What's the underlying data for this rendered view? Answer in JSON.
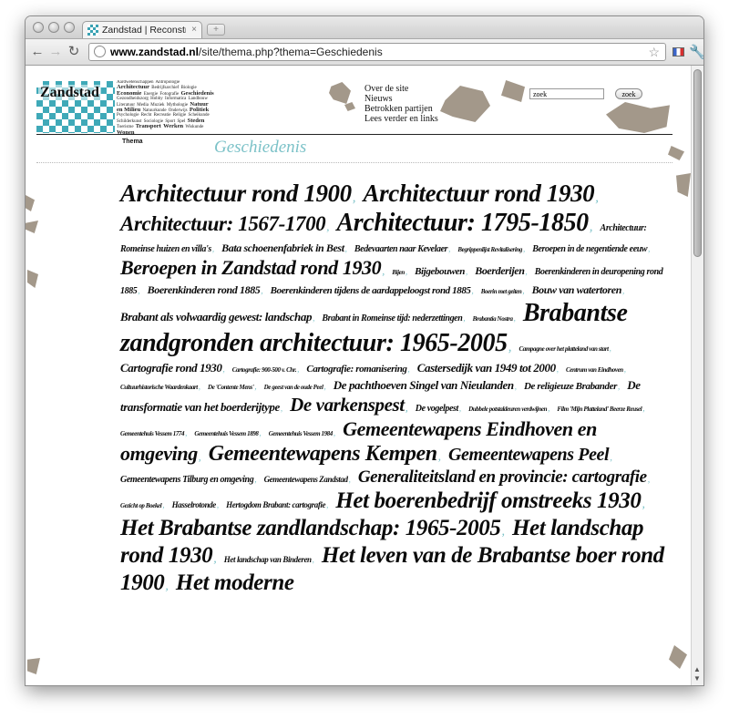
{
  "browser": {
    "tab_title": "Zandstad | Reconstructie van",
    "tab_close": "×",
    "url_host": "www.zandstad.nl",
    "url_path": "/site/thema.php?thema=Geschiedenis"
  },
  "site": {
    "logo_text": "Zandstad",
    "mini_tags": [
      "Aardwetenschappen",
      "Antropologie",
      "Architectuur",
      "Bedrijfsarchief",
      "Biologie",
      "Economie",
      "Energie",
      "Fotografie",
      "Geschiedenis",
      "Gezondheidszorg",
      "Hobby",
      "Informatica",
      "Landbouw",
      "Literatuur",
      "Media",
      "Muziek",
      "Mythologie",
      "Natuur en Milieu",
      "Natuurkunde",
      "Onderwijs",
      "Politiek",
      "Psychologie",
      "Recht",
      "Recreatie",
      "Religie",
      "Scheikunde",
      "Schilderkunst",
      "Sociologie",
      "Sport",
      "Spel",
      "Steden",
      "Toerisme",
      "Transport",
      "Werken",
      "Wiskunde",
      "Wonen"
    ],
    "nav": [
      "Over de site",
      "Nieuws",
      "Betrokken partijen",
      "Lees verder en links"
    ],
    "search_value": "zoek",
    "search_button": "zoek",
    "thema_label": "Thema",
    "section_title": "Geschiedenis"
  },
  "cloud": {
    "accent_color": "#7cc2c8",
    "separator": ",",
    "tags": [
      {
        "label": "Architectuur rond 1900",
        "size": 27
      },
      {
        "label": "Architectuur rond 1930",
        "size": 27
      },
      {
        "label": "Architectuur: 1567-1700",
        "size": 23
      },
      {
        "label": "Architectuur: 1795-1850",
        "size": 28
      },
      {
        "label": "Architectuur: Romeinse huizen en villa's",
        "size": 10
      },
      {
        "label": "Bata schoenenfabriek in Best",
        "size": 12
      },
      {
        "label": "Bedevaarten naar Kevelaer",
        "size": 10
      },
      {
        "label": "Begrippenlijst Revitalisering",
        "size": 7
      },
      {
        "label": "Beroepen in de negentiende eeuw",
        "size": 10
      },
      {
        "label": "Beroepen in Zandstad rond 1930",
        "size": 22
      },
      {
        "label": "Bijen",
        "size": 7
      },
      {
        "label": "Bijgebouwen",
        "size": 11
      },
      {
        "label": "Boerderijen",
        "size": 12
      },
      {
        "label": "Boerenkinderen in deuropening rond 1885",
        "size": 10
      },
      {
        "label": "Boerenkinderen rond 1885",
        "size": 12
      },
      {
        "label": "Boerenkinderen tijdens de aardappeloogst rond 1885",
        "size": 11
      },
      {
        "label": "Boerin met geiten",
        "size": 7
      },
      {
        "label": "Bouw van watertoren",
        "size": 12
      },
      {
        "label": "Brabant als volwaardig gewest: landschap",
        "size": 13
      },
      {
        "label": "Brabant in Romeinse tijd: nederzettingen",
        "size": 10
      },
      {
        "label": "Brabantia Nostra",
        "size": 7
      },
      {
        "label": "Brabantse zandgronden architectuur: 1965-2005",
        "size": 28
      },
      {
        "label": "Campagne over het platteland van start",
        "size": 7
      },
      {
        "label": "Cartografie rond 1930",
        "size": 13
      },
      {
        "label": "Cartografie: 900-500 v. Chr.",
        "size": 7
      },
      {
        "label": "Cartografie: romanisering",
        "size": 11
      },
      {
        "label": "Castersedijk van 1949 tot 2000",
        "size": 13
      },
      {
        "label": "Centrum van Eindhoven",
        "size": 7
      },
      {
        "label": "Cultuurhistorische Waardenkaart",
        "size": 7
      },
      {
        "label": "De 'Contente Mens'",
        "size": 7
      },
      {
        "label": "De geest van de oude Peel",
        "size": 7
      },
      {
        "label": "De pachthoeven Singel van Nieulanden",
        "size": 13
      },
      {
        "label": "De religieuze Brabander",
        "size": 11
      },
      {
        "label": "De transformatie van het boerderijtype",
        "size": 13
      },
      {
        "label": "De varkenspest",
        "size": 21
      },
      {
        "label": "De vogelpest",
        "size": 10
      },
      {
        "label": "Dubbele potstaldeuren verdwijnen",
        "size": 7
      },
      {
        "label": "Film 'Mijn Platteland' Beerze Reusel",
        "size": 7
      },
      {
        "label": "Gemeentehuis Vessem 1774",
        "size": 7
      },
      {
        "label": "Gemeentehuis Vessem 1898",
        "size": 7
      },
      {
        "label": "Gemeentehuis Vessem 1984",
        "size": 7
      },
      {
        "label": "Gemeentewapens Eindhoven en omgeving",
        "size": 22
      },
      {
        "label": "Gemeentewapens Kempen",
        "size": 24
      },
      {
        "label": "Gemeentewapens Peel",
        "size": 20
      },
      {
        "label": "Gemeentewapens Tilburg en omgeving",
        "size": 10
      },
      {
        "label": "Gemeentewapens Zandstad",
        "size": 9
      },
      {
        "label": "Generaliteitsland en provincie: cartografie",
        "size": 19
      },
      {
        "label": "Gezicht op Boekel",
        "size": 7
      },
      {
        "label": "Hasselrotonde",
        "size": 9
      },
      {
        "label": "Hertogdom Brabant: cartografie",
        "size": 9
      },
      {
        "label": "Het boerenbedrijf omstreeks 1930",
        "size": 25
      },
      {
        "label": "Het Brabantse zandlandschap: 1965-2005",
        "size": 25
      },
      {
        "label": "Het landschap rond 1930",
        "size": 25
      },
      {
        "label": "Het landschap van Binderen",
        "size": 9
      },
      {
        "label": "Het leven van de Brabantse boer rond 1900",
        "size": 25
      },
      {
        "label": "Het moderne",
        "size": 25
      }
    ]
  }
}
